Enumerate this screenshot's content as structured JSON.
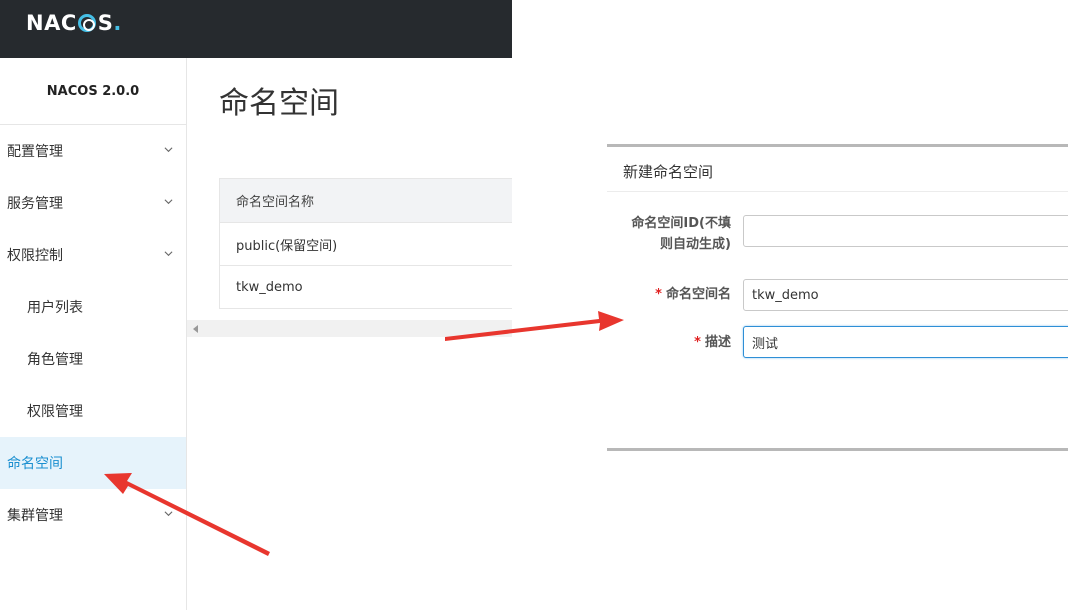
{
  "header": {
    "logo_text": "NACOS",
    "accent_color": "#45bfe6"
  },
  "sidebar": {
    "version": "NACOS 2.0.0",
    "items": [
      {
        "label": "配置管理",
        "expandable": true
      },
      {
        "label": "服务管理",
        "expandable": true
      },
      {
        "label": "权限控制",
        "expandable": true
      },
      {
        "label": "用户列表",
        "sub": true
      },
      {
        "label": "角色管理",
        "sub": true
      },
      {
        "label": "权限管理",
        "sub": true
      },
      {
        "label": "命名空间",
        "active": true
      },
      {
        "label": "集群管理",
        "expandable": true
      }
    ]
  },
  "main": {
    "title": "命名空间",
    "table": {
      "header": "命名空间名称",
      "rows": [
        "public(保留空间)",
        "tkw_demo"
      ]
    }
  },
  "dialog": {
    "title": "新建命名空间",
    "fields": {
      "id": {
        "label_line1": "命名空间ID(不填",
        "label_line2": "则自动生成)",
        "value": ""
      },
      "name": {
        "required_mark": "*",
        "label": "命名空间名",
        "value": "tkw_demo"
      },
      "desc": {
        "required_mark": "*",
        "label": "描述",
        "value": "测试"
      }
    }
  },
  "annotation": {
    "arrow_color": "#e8362e"
  }
}
